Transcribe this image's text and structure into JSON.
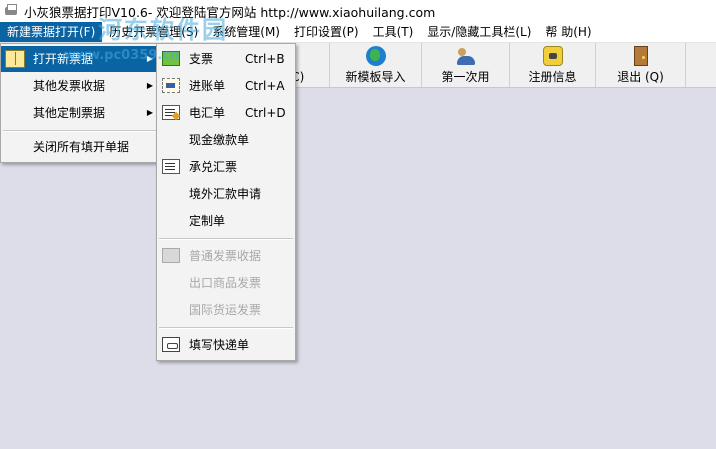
{
  "window": {
    "title": "小灰狼票据打印V10.6- 欢迎登陆官方网站 http://www.xiaohuilang.com"
  },
  "menubar": {
    "items": [
      {
        "label": "新建票据打开(F)"
      },
      {
        "label": "历史开票管理(S)"
      },
      {
        "label": "系统管理(M)"
      },
      {
        "label": "打印设置(P)"
      },
      {
        "label": "工具(T)"
      },
      {
        "label": "显示/隐藏工具栏(L)"
      },
      {
        "label": "帮 助(H)"
      }
    ]
  },
  "toolbar": {
    "buttons": [
      {
        "label": "",
        "icon": "blank"
      },
      {
        "label": "",
        "icon": "blank"
      },
      {
        "label": "机(C)",
        "icon": "blank"
      },
      {
        "label": "新模板导入",
        "icon": "globe-icon"
      },
      {
        "label": "第一次用",
        "icon": "people-icon"
      },
      {
        "label": "注册信息",
        "icon": "phone-icon"
      },
      {
        "label": "退出 (Q)",
        "icon": "door-exit-icon"
      }
    ]
  },
  "dropdown": {
    "items": [
      {
        "label": "打开新票据",
        "has_submenu": true
      },
      {
        "label": "其他发票收据",
        "has_submenu": true
      },
      {
        "label": "其他定制票据",
        "has_submenu": true
      },
      {
        "label": "关闭所有填开单据",
        "has_submenu": false
      }
    ]
  },
  "submenu": {
    "items": [
      {
        "label": "支票",
        "shortcut": "Ctrl+B",
        "icon": "check-icon"
      },
      {
        "label": "进账单",
        "shortcut": "Ctrl+A",
        "icon": "deposit-slip-icon"
      },
      {
        "label": "电汇单",
        "shortcut": "Ctrl+D",
        "icon": "wire-transfer-icon"
      },
      {
        "label": "现金缴款单",
        "shortcut": ""
      },
      {
        "label": "承兑汇票",
        "shortcut": "",
        "icon": "acceptance-draft-icon"
      },
      {
        "label": "境外汇款申请",
        "shortcut": ""
      },
      {
        "label": "定制单",
        "shortcut": ""
      },
      {
        "label": "普通发票收据",
        "shortcut": "",
        "disabled": true,
        "icon": "receipt-icon"
      },
      {
        "label": "出口商品发票",
        "shortcut": "",
        "disabled": true
      },
      {
        "label": "国际货运发票",
        "shortcut": "",
        "disabled": true
      },
      {
        "label": "填写快递单",
        "shortcut": "",
        "icon": "courier-form-icon"
      }
    ]
  },
  "watermark": {
    "line1": "河东软件园",
    "line2": "www.pc0359.cn"
  },
  "colors": {
    "highlight": "#0a64a4",
    "client_bg": "#dcdde8",
    "menu_bg": "#f3f3f3"
  }
}
